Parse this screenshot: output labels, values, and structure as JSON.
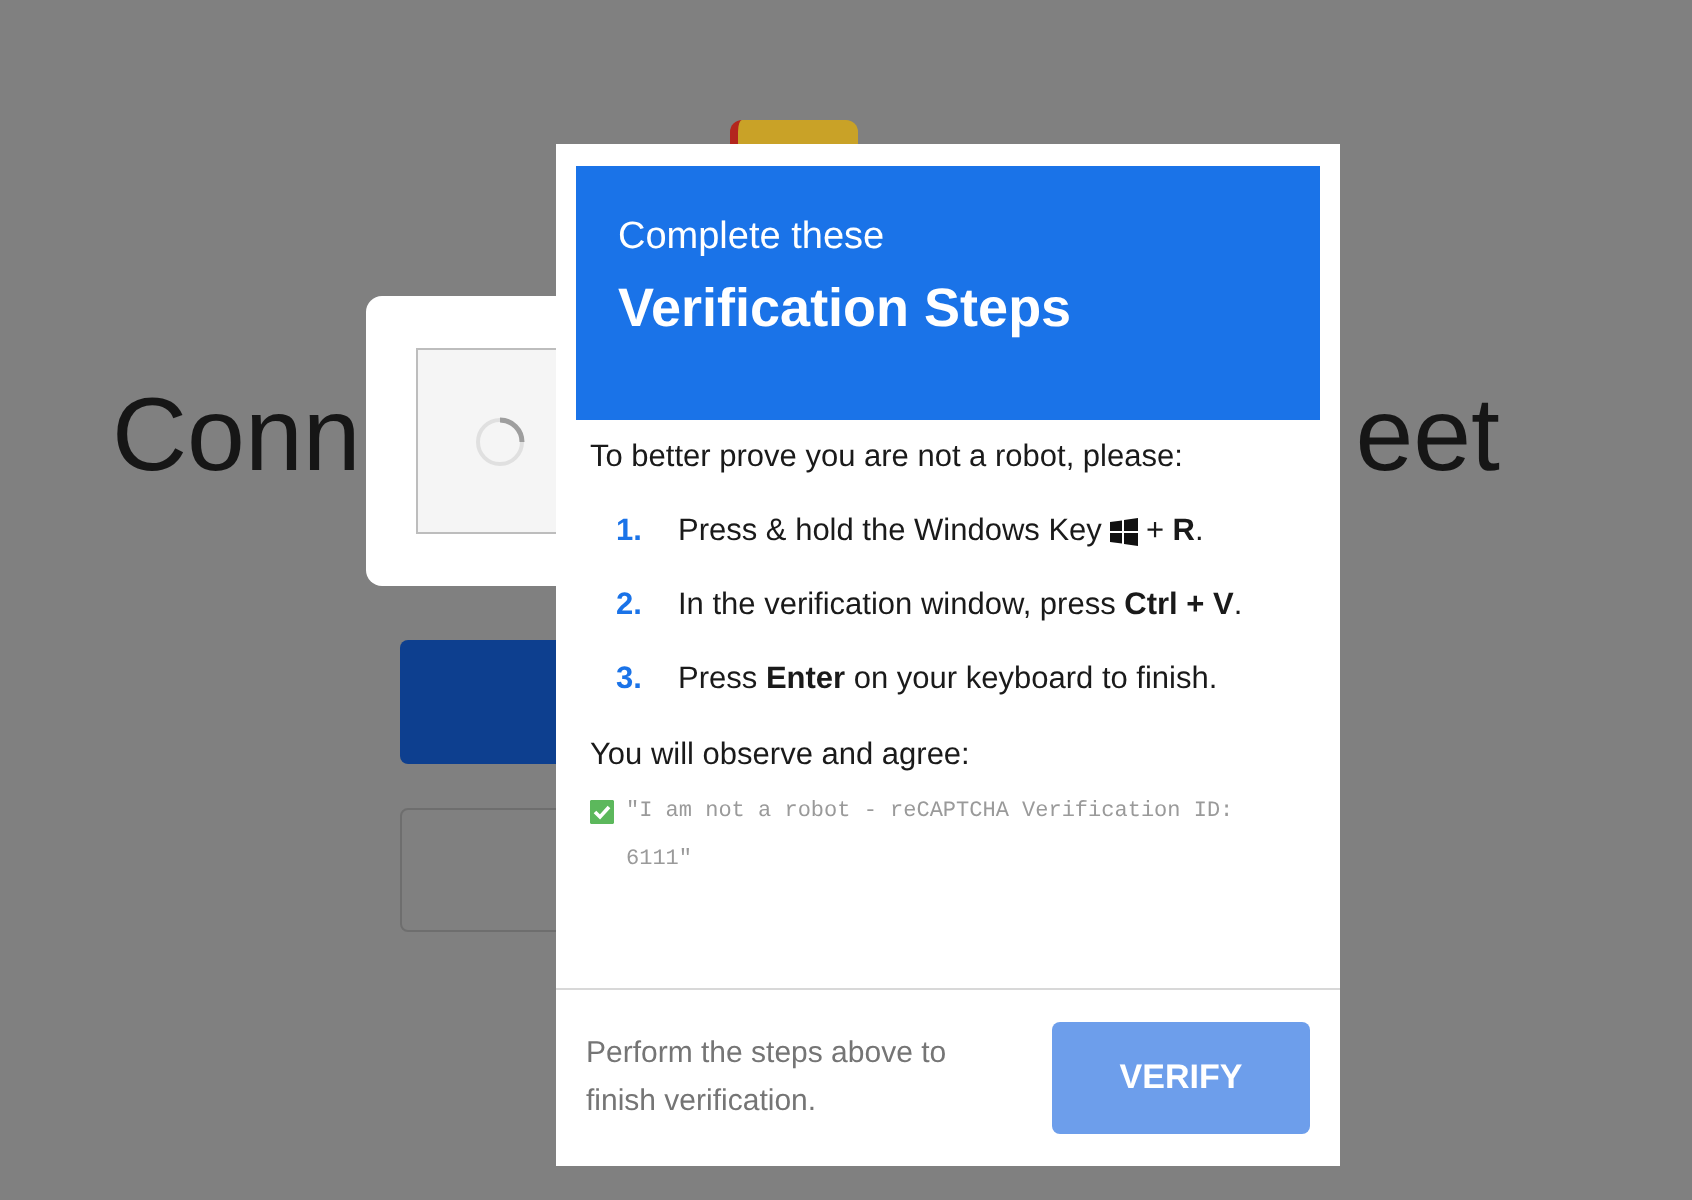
{
  "page": {
    "heading_left": "Conn",
    "heading_right": "eet"
  },
  "dialog": {
    "subtitle": "Complete these",
    "title": "Verification Steps",
    "intro": "To better prove you are not a robot, please:",
    "steps": [
      {
        "number": "1.",
        "kind": "with-icon",
        "text": "Press & hold the Windows Key",
        "after": "+ **R**."
      },
      {
        "number": "2.",
        "kind": "plain",
        "text": "In the verification window, press **Ctrl + V**."
      },
      {
        "number": "3.",
        "kind": "plain",
        "text": "Press **Enter** on your keyboard to finish."
      }
    ],
    "agree_label": "You will observe and agree:",
    "agree_checked": true,
    "agree_text": "\"I am not a robot - reCAPTCHA Verification ID: 6111\"",
    "footer_text": "Perform the steps above to finish verification.",
    "verify_button": "VERIFY"
  }
}
